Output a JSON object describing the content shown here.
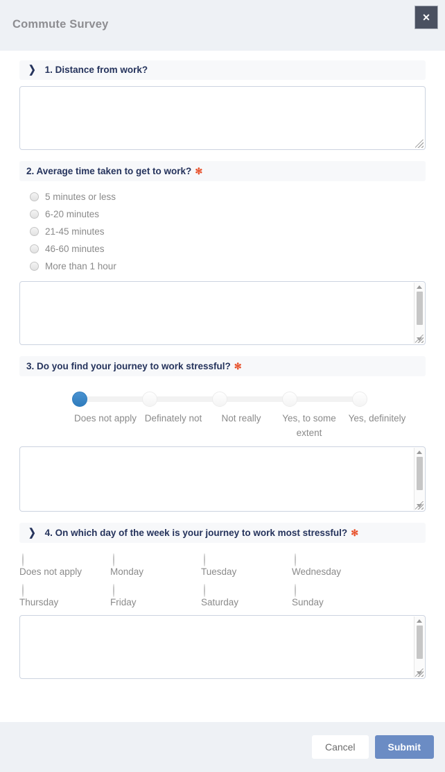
{
  "header": {
    "title": "Commute Survey",
    "close_label": "✕"
  },
  "questions": [
    {
      "id": "q1",
      "chevron": "❯",
      "has_chevron": true,
      "text": "1. Distance from work?",
      "required": false,
      "required_marker": "",
      "type": "textarea",
      "value": "",
      "scrollbar": false
    },
    {
      "id": "q2",
      "chevron": "",
      "has_chevron": false,
      "text": "2. Average time taken to get to work?",
      "required": true,
      "required_marker": "✻",
      "type": "radio-list",
      "options": [
        "5 minutes or less",
        "6-20 minutes",
        "21-45 minutes",
        "46-60 minutes",
        "More than 1 hour"
      ],
      "selected": null,
      "value": "",
      "scrollbar": true
    },
    {
      "id": "q3",
      "chevron": "",
      "has_chevron": false,
      "text": "3. Do you find your journey to work stressful?",
      "required": true,
      "required_marker": "✻",
      "type": "slider",
      "options": [
        "Does not apply",
        "Definately not",
        "Not really",
        "Yes, to some extent",
        "Yes, definitely"
      ],
      "selected_index": 0,
      "value": "",
      "scrollbar": true
    },
    {
      "id": "q4",
      "chevron": "❯",
      "has_chevron": true,
      "text": "4. On which day of the week is your journey to work most stressful?",
      "required": true,
      "required_marker": "✻",
      "type": "radio-grid",
      "options": [
        "Does not apply",
        "Monday",
        "Tuesday",
        "Wednesday",
        "Thursday",
        "Friday",
        "Saturday",
        "Sunday"
      ],
      "selected": null,
      "value": "",
      "scrollbar": true
    }
  ],
  "footer": {
    "cancel_label": "Cancel",
    "submit_label": "Submit"
  },
  "colors": {
    "header_bg": "#eef1f5",
    "question_bar_bg": "#f7f8fa",
    "question_text": "#25335c",
    "required_red": "#e8512b",
    "slider_active": "#2f7cbd",
    "submit_bg": "#6b8cc4",
    "close_bg": "#4a5161",
    "muted_text": "#8a8a8a"
  }
}
